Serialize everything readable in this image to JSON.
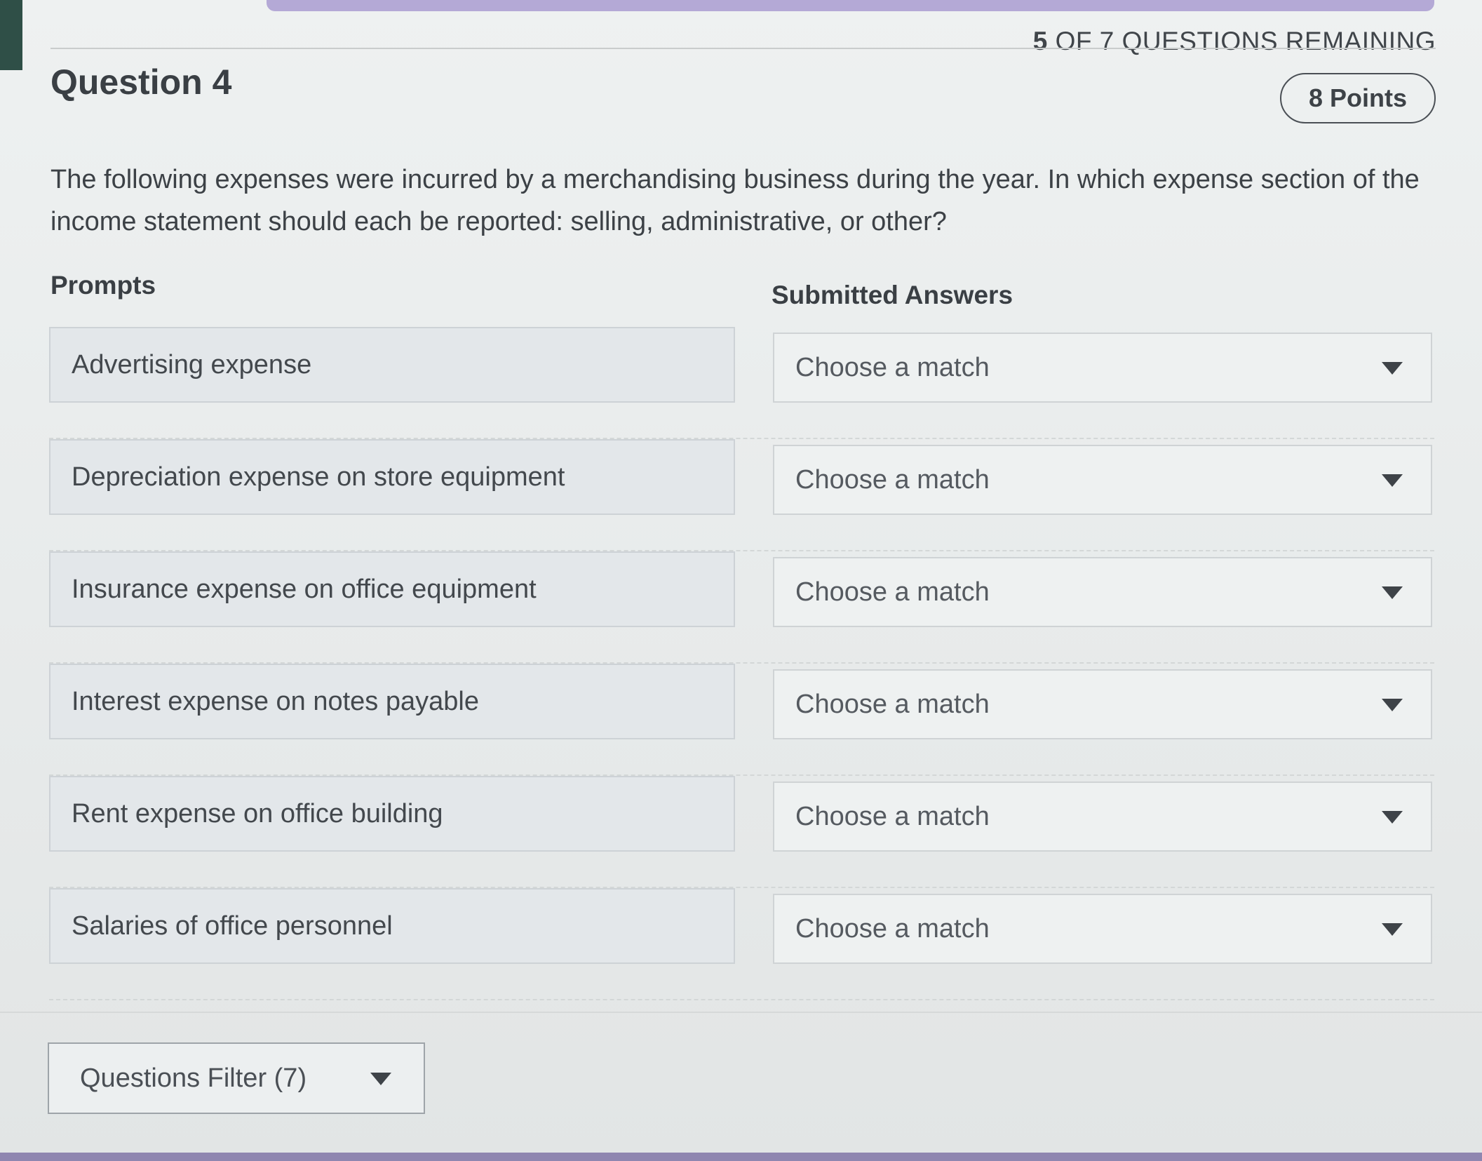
{
  "header": {
    "remaining_count": "5",
    "remaining_text": " OF 7 QUESTIONS REMAINING",
    "question_title": "Question 4",
    "points": "8 Points"
  },
  "question": {
    "text": "The following expenses were incurred by a merchandising business during the year. In which expense section of the income statement should each be reported: selling, administrative, or other?"
  },
  "columns": {
    "prompts": "Prompts",
    "answers": "Submitted Answers"
  },
  "rows": [
    {
      "prompt": "Advertising expense",
      "answer": "Choose a match"
    },
    {
      "prompt": "Depreciation expense on store equipment",
      "answer": "Choose a match"
    },
    {
      "prompt": "Insurance expense on office equipment",
      "answer": "Choose a match"
    },
    {
      "prompt": "Interest expense on notes payable",
      "answer": "Choose a match"
    },
    {
      "prompt": "Rent expense on office building",
      "answer": "Choose a match"
    },
    {
      "prompt": "Salaries of office personnel",
      "answer": "Choose a match"
    }
  ],
  "footer": {
    "filter_label": "Questions Filter (7)"
  },
  "icons": {
    "dropdown": "chevron-down-icon"
  },
  "colors": {
    "accent_top": "#b4a9d6",
    "accent_bottom": "#8f86b0",
    "text": "#3a3f44"
  }
}
